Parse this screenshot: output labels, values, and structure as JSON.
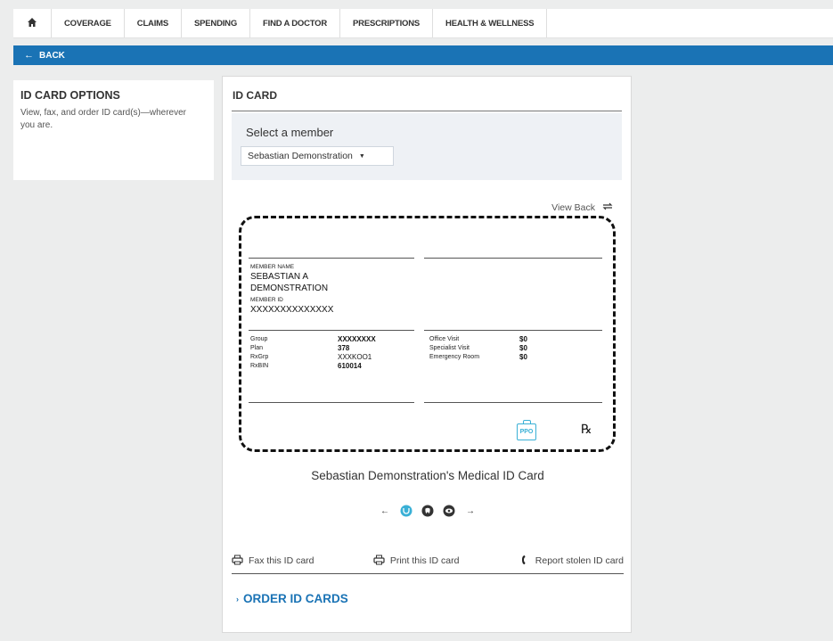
{
  "nav": {
    "items": [
      "COVERAGE",
      "CLAIMS",
      "SPENDING",
      "FIND A DOCTOR",
      "PRESCRIPTIONS",
      "HEALTH & WELLNESS"
    ],
    "home_icon": "home-icon"
  },
  "back": {
    "label": "BACK"
  },
  "sidebar": {
    "title": "ID CARD OPTIONS",
    "description": "View, fax, and order ID card(s)—wherever you are."
  },
  "idcard_panel": {
    "title": "ID CARD",
    "select_label": "Select a member",
    "selected_member": "Sebastian Demonstration",
    "view_back": "View Back",
    "caption": "Sebastian Demonstration's Medical ID Card"
  },
  "card": {
    "member_name_label": "MEMBER NAME",
    "member_name_line1": "SEBASTIAN A",
    "member_name_line2": "DEMONSTRATION",
    "member_id_label": "MEMBER ID",
    "member_id": "XXXXXXXXXXXXXX",
    "plan_rows": [
      {
        "label": "Group",
        "value": "XXXXXXXX"
      },
      {
        "label": "Plan",
        "value": "378"
      },
      {
        "label": "RxGrp",
        "value": "XXXKOO1"
      },
      {
        "label": "RxBIN",
        "value": "610014"
      }
    ],
    "copay_rows": [
      {
        "label": "Office Visit",
        "value": "$0"
      },
      {
        "label": "Specialist Visit",
        "value": "$0"
      },
      {
        "label": "Emergency Room",
        "value": "$0"
      }
    ],
    "ppo_badge": "PPO",
    "rx_symbol": "℞"
  },
  "actions": {
    "fax": "Fax this ID card",
    "print": "Print this ID card",
    "report": "Report stolen ID card"
  },
  "order": {
    "label": "ORDER ID CARDS"
  },
  "colors": {
    "brand_blue": "#1a73b5",
    "ppo_blue": "#3ab0d6"
  }
}
